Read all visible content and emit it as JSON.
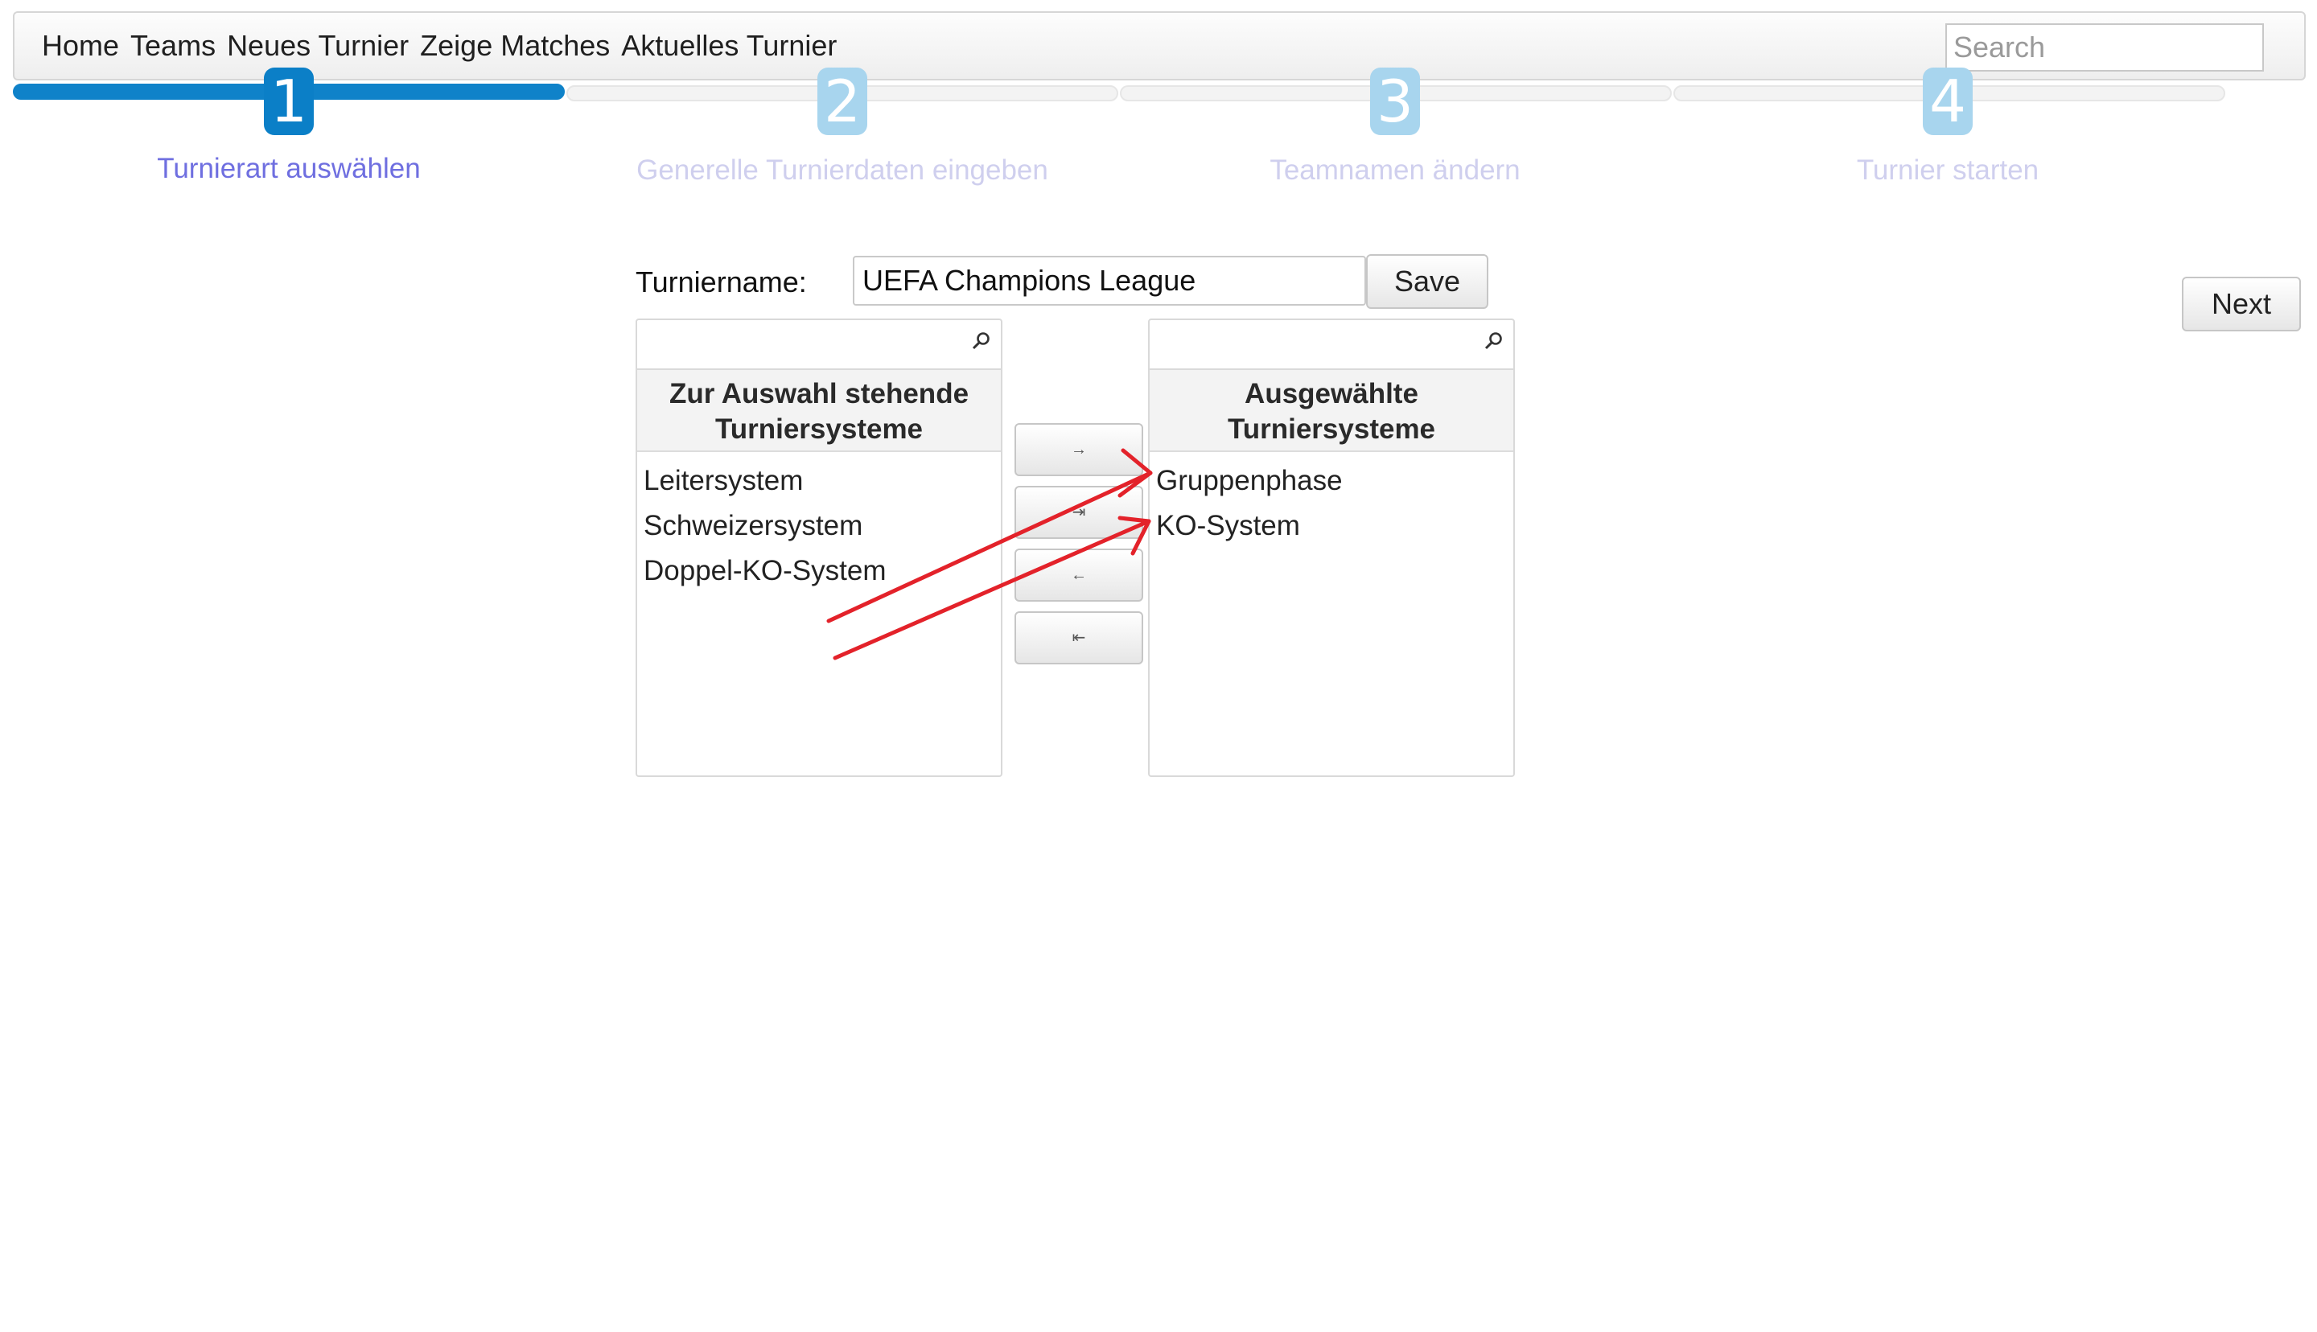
{
  "nav": {
    "links": [
      "Home",
      "Teams",
      "Neues Turnier",
      "Zeige Matches",
      "Aktuelles Turnier"
    ],
    "search_placeholder": "Search"
  },
  "wizard": {
    "active_step": 1,
    "steps": [
      {
        "number": "1",
        "label": "Turnierart auswählen"
      },
      {
        "number": "2",
        "label": "Generelle Turnierdaten eingeben"
      },
      {
        "number": "3",
        "label": "Teamnamen ändern"
      },
      {
        "number": "4",
        "label": "Turnier starten"
      }
    ]
  },
  "form": {
    "name_label": "Turniername:",
    "name_value": "UEFA Champions League",
    "save_label": "Save",
    "next_label": "Next"
  },
  "available": {
    "header": "Zur Auswahl stehende Turniersysteme",
    "items": [
      "Leitersystem",
      "Schweizersystem",
      "Doppel-KO-System"
    ]
  },
  "selected": {
    "header": "Ausgewählte Turniersysteme",
    "items": [
      "Gruppenphase",
      "KO-System"
    ]
  },
  "transfer_buttons": {
    "move_right": "→",
    "move_all_right": "⇥",
    "move_left": "←",
    "move_all_left": "⇤"
  },
  "colors": {
    "active_step": "#0b7fc7",
    "inactive_step": "#a8d5ee",
    "active_label": "#6f6fe0",
    "annotation_arrow": "#e3222a"
  }
}
